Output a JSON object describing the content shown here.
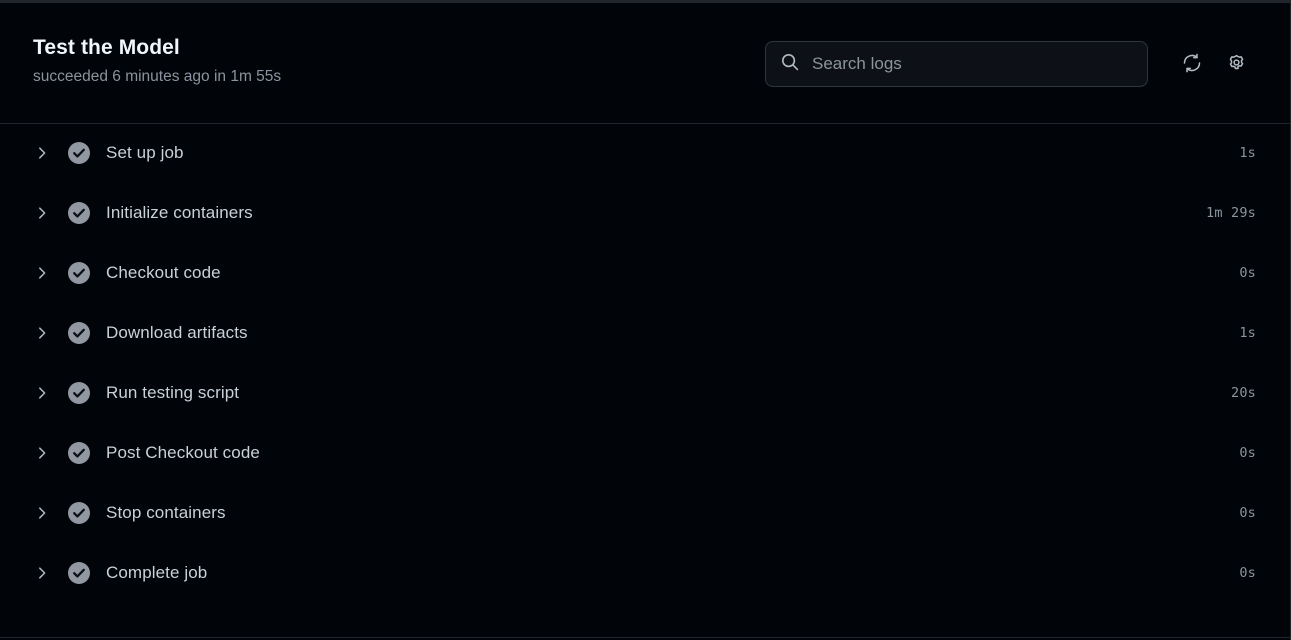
{
  "header": {
    "title": "Test the Model",
    "status": "succeeded 6 minutes ago in 1m 55s",
    "search": {
      "placeholder": "Search logs",
      "value": "",
      "icon": "search-icon"
    },
    "actions": [
      {
        "name": "refresh-button",
        "icon": "refresh-icon",
        "label": "Refresh"
      },
      {
        "name": "settings-button",
        "icon": "gear-icon",
        "label": "Settings"
      }
    ]
  },
  "colors": {
    "background": "#010409",
    "surface": "#0d1117",
    "border": "#30363d",
    "divider": "#21262d",
    "text_primary": "#c9d1d9",
    "title": "#f0f6fc",
    "text_muted": "#8b949e",
    "status_success": "#8b949e"
  },
  "steps": [
    {
      "label": "Set up job",
      "duration": "1s",
      "status": "succeeded",
      "expanded": false,
      "icon": "check-circle-icon",
      "chevron": "chevron-right-icon"
    },
    {
      "label": "Initialize containers",
      "duration": "1m 29s",
      "status": "succeeded",
      "expanded": false,
      "icon": "check-circle-icon",
      "chevron": "chevron-right-icon"
    },
    {
      "label": "Checkout code",
      "duration": "0s",
      "status": "succeeded",
      "expanded": false,
      "icon": "check-circle-icon",
      "chevron": "chevron-right-icon"
    },
    {
      "label": "Download artifacts",
      "duration": "1s",
      "status": "succeeded",
      "expanded": false,
      "icon": "check-circle-icon",
      "chevron": "chevron-right-icon"
    },
    {
      "label": "Run testing script",
      "duration": "20s",
      "status": "succeeded",
      "expanded": false,
      "icon": "check-circle-icon",
      "chevron": "chevron-right-icon"
    },
    {
      "label": "Post Checkout code",
      "duration": "0s",
      "status": "succeeded",
      "expanded": false,
      "icon": "check-circle-icon",
      "chevron": "chevron-right-icon"
    },
    {
      "label": "Stop containers",
      "duration": "0s",
      "status": "succeeded",
      "expanded": false,
      "icon": "check-circle-icon",
      "chevron": "chevron-right-icon"
    },
    {
      "label": "Complete job",
      "duration": "0s",
      "status": "succeeded",
      "expanded": false,
      "icon": "check-circle-icon",
      "chevron": "chevron-right-icon"
    }
  ]
}
